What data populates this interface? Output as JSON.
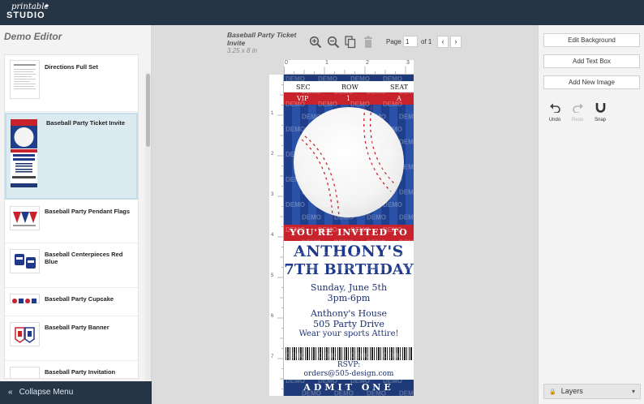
{
  "brand": {
    "line1": "printable",
    "line2": "STUDIO"
  },
  "sidebar": {
    "title": "Demo Editor",
    "items": [
      {
        "label": "Directions Full Set"
      },
      {
        "label": "Baseball Party Ticket Invite"
      },
      {
        "label": "Baseball Party Pendant Flags"
      },
      {
        "label": "Baseball Centerpieces Red Blue"
      },
      {
        "label": "Baseball Party Cupcake"
      },
      {
        "label": "Baseball Party Banner"
      },
      {
        "label": "Baseball Party Invitation"
      }
    ],
    "collapse_label": "Collapse Menu"
  },
  "document": {
    "title": "Baseball Party Ticket Invite",
    "size": "3.25 x 8 in",
    "page_label": "Page",
    "page_value": "1",
    "page_total": "of 1",
    "ruler_marks": [
      "0",
      "1",
      "2",
      "3"
    ],
    "ruler_left_marks": [
      "1",
      "2",
      "3",
      "4",
      "5",
      "6",
      "7"
    ]
  },
  "ticket": {
    "header": [
      "SEC",
      "ROW",
      "SEAT"
    ],
    "values": [
      "VIP",
      "1",
      "A"
    ],
    "invited": "YOU'RE INVITED TO",
    "name": "ANTHONY'S",
    "occasion": "7TH BIRTHDAY",
    "date": "Sunday, June 5th",
    "time": "3pm-6pm",
    "place": "Anthony's House",
    "address": "505 Party Drive",
    "note": "Wear your sports Attire!",
    "rsvp_label": "RSVP:",
    "rsvp_email": "orders@505-design.com",
    "admit": "ADMIT ONE",
    "watermark": "DEMO"
  },
  "right_panel": {
    "edit_background": "Edit Background",
    "add_text_box": "Add Text Box",
    "add_new_image": "Add New Image",
    "undo": "Undo",
    "redo": "Redo",
    "snap": "Snap",
    "layers": "Layers"
  },
  "colors": {
    "topbar": "#263546",
    "ticket_red": "#c8232c",
    "ticket_blue": "#1f3a8c"
  }
}
